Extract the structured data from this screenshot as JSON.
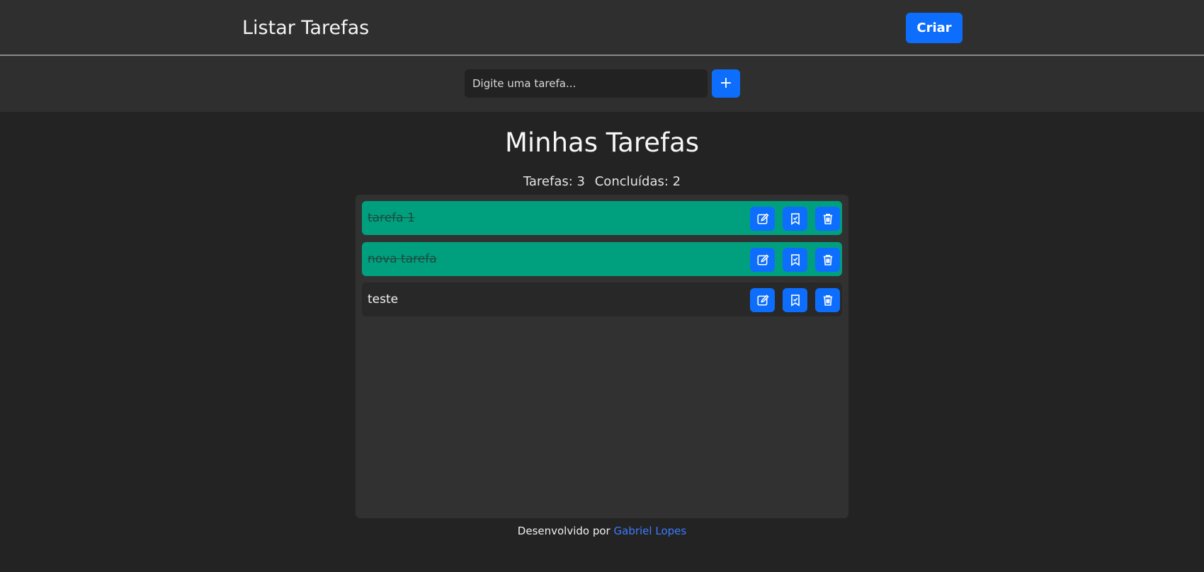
{
  "navbar": {
    "brand": "Listar Tarefas",
    "create_label": "Criar"
  },
  "input_bar": {
    "placeholder": "Digite uma tarefa...",
    "add_label": "+"
  },
  "main": {
    "title": "Minhas Tarefas",
    "stats": {
      "total_label": "Tarefas:",
      "total": "3",
      "done_label": "Concluídas:",
      "done": "2"
    }
  },
  "tasks": [
    {
      "text": "tarefa 1",
      "status": "done"
    },
    {
      "text": "nova tarefa",
      "status": "done"
    },
    {
      "text": "teste",
      "status": "pending"
    }
  ],
  "icons": {
    "edit": "edit-icon",
    "complete": "bookmark-check-icon",
    "delete": "trash-icon"
  },
  "colors": {
    "accent": "#0d6efd",
    "done": "#00a07f",
    "background": "#232323"
  },
  "footer": {
    "prefix": "Desenvolvido por",
    "author": "Gabriel Lopes"
  }
}
